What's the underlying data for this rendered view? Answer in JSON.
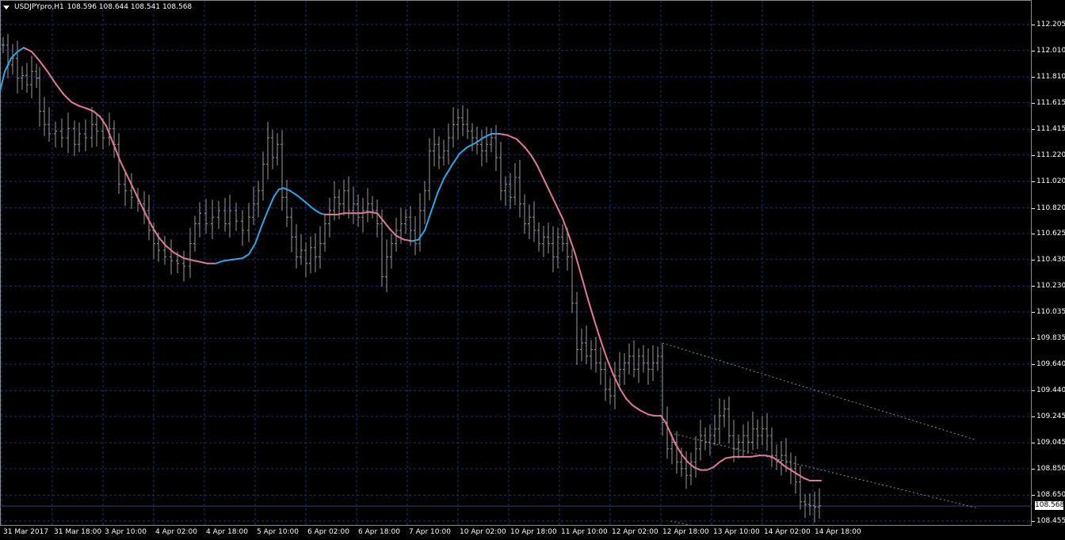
{
  "header": {
    "symbol": "USDJPYpro,H1",
    "ohlc": "108.596 108.644 108.541 108.568"
  },
  "colors": {
    "background": "#000000",
    "grid": "#1c2f6e",
    "bars": "#9a9a9a",
    "ma_rising": "#2aa7e6",
    "ma_falling": "#e07a95",
    "channel": "#8a8a8a",
    "axis_text": "#ffffff"
  },
  "price_axis": {
    "ticks": [
      "112.205",
      "112.010",
      "111.810",
      "111.615",
      "111.415",
      "111.220",
      "111.020",
      "110.820",
      "110.625",
      "110.430",
      "110.230",
      "110.035",
      "109.835",
      "109.640",
      "109.440",
      "109.245",
      "109.045",
      "108.850",
      "108.650",
      "108.455"
    ],
    "current_price": "108.568"
  },
  "time_axis": {
    "ticks": [
      "31 Mar 2017",
      "31 Mar 18:00",
      "3 Apr 10:00",
      "4 Apr 02:00",
      "4 Apr 18:00",
      "5 Apr 10:00",
      "6 Apr 02:00",
      "6 Apr 18:00",
      "7 Apr 10:00",
      "10 Apr 02:00",
      "10 Apr 18:00",
      "11 Apr 10:00",
      "12 Apr 02:00",
      "12 Apr 18:00",
      "13 Apr 10:00",
      "14 Apr 02:00",
      "14 Apr 18:00"
    ]
  },
  "chart_data": {
    "type": "ohlc_bars",
    "ylim": [
      108.455,
      112.205
    ],
    "ma_path": [
      [
        0,
        111.7
      ],
      [
        6,
        111.85
      ],
      [
        14,
        111.95
      ],
      [
        22,
        112.0
      ],
      [
        30,
        112.03
      ],
      [
        40,
        112.0
      ],
      [
        50,
        111.93
      ],
      [
        60,
        111.85
      ],
      [
        70,
        111.76
      ],
      [
        80,
        111.68
      ],
      [
        90,
        111.62
      ],
      [
        100,
        111.59
      ],
      [
        110,
        111.57
      ],
      [
        118,
        111.55
      ],
      [
        126,
        111.51
      ],
      [
        134,
        111.44
      ],
      [
        140,
        111.35
      ],
      [
        146,
        111.26
      ],
      [
        152,
        111.17
      ],
      [
        160,
        111.07
      ],
      [
        168,
        110.97
      ],
      [
        176,
        110.87
      ],
      [
        184,
        110.77
      ],
      [
        192,
        110.68
      ],
      [
        200,
        110.6
      ],
      [
        210,
        110.53
      ],
      [
        220,
        110.48
      ],
      [
        232,
        110.44
      ],
      [
        246,
        110.42
      ],
      [
        262,
        110.4
      ],
      [
        272,
        110.4
      ],
      [
        282,
        110.42
      ],
      [
        294,
        110.43
      ],
      [
        306,
        110.44
      ],
      [
        314,
        110.47
      ],
      [
        322,
        110.55
      ],
      [
        330,
        110.68
      ],
      [
        338,
        110.8
      ],
      [
        346,
        110.91
      ],
      [
        352,
        110.96
      ],
      [
        358,
        110.97
      ],
      [
        366,
        110.95
      ],
      [
        376,
        110.91
      ],
      [
        386,
        110.86
      ],
      [
        396,
        110.81
      ],
      [
        404,
        110.78
      ],
      [
        410,
        110.77
      ],
      [
        418,
        110.77
      ],
      [
        426,
        110.77
      ],
      [
        434,
        110.78
      ],
      [
        444,
        110.78
      ],
      [
        456,
        110.78
      ],
      [
        466,
        110.79
      ],
      [
        476,
        110.78
      ],
      [
        484,
        110.72
      ],
      [
        492,
        110.66
      ],
      [
        500,
        110.61
      ],
      [
        510,
        110.58
      ],
      [
        520,
        110.57
      ],
      [
        528,
        110.58
      ],
      [
        536,
        110.65
      ],
      [
        544,
        110.79
      ],
      [
        552,
        110.93
      ],
      [
        560,
        111.04
      ],
      [
        570,
        111.14
      ],
      [
        580,
        111.23
      ],
      [
        590,
        111.28
      ],
      [
        600,
        111.31
      ],
      [
        610,
        111.35
      ],
      [
        620,
        111.38
      ],
      [
        630,
        111.38
      ],
      [
        640,
        111.37
      ],
      [
        652,
        111.34
      ],
      [
        662,
        111.28
      ],
      [
        670,
        111.22
      ],
      [
        678,
        111.14
      ],
      [
        686,
        111.04
      ],
      [
        694,
        110.94
      ],
      [
        702,
        110.84
      ],
      [
        710,
        110.74
      ],
      [
        718,
        110.61
      ],
      [
        726,
        110.47
      ],
      [
        734,
        110.3
      ],
      [
        742,
        110.13
      ],
      [
        750,
        109.97
      ],
      [
        758,
        109.82
      ],
      [
        766,
        109.68
      ],
      [
        774,
        109.56
      ],
      [
        782,
        109.46
      ],
      [
        790,
        109.38
      ],
      [
        798,
        109.33
      ],
      [
        808,
        109.29
      ],
      [
        818,
        109.26
      ],
      [
        826,
        109.25
      ],
      [
        834,
        109.25
      ],
      [
        840,
        109.2
      ],
      [
        846,
        109.12
      ],
      [
        852,
        109.04
      ],
      [
        860,
        108.96
      ],
      [
        868,
        108.9
      ],
      [
        876,
        108.86
      ],
      [
        884,
        108.84
      ],
      [
        892,
        108.84
      ],
      [
        900,
        108.86
      ],
      [
        908,
        108.9
      ],
      [
        916,
        108.93
      ],
      [
        926,
        108.94
      ],
      [
        936,
        108.94
      ],
      [
        948,
        108.94
      ],
      [
        958,
        108.95
      ],
      [
        966,
        108.95
      ],
      [
        974,
        108.94
      ],
      [
        982,
        108.91
      ],
      [
        990,
        108.87
      ],
      [
        998,
        108.84
      ],
      [
        1006,
        108.81
      ],
      [
        1014,
        108.78
      ],
      [
        1022,
        108.76
      ],
      [
        1032,
        108.76
      ],
      [
        1036,
        108.76
      ]
    ],
    "ma_turns": [
      30,
      272,
      358,
      410,
      520,
      630
    ],
    "close_path": [
      [
        4,
        112.05
      ],
      [
        10,
        111.9
      ],
      [
        16,
        111.95
      ],
      [
        22,
        111.8
      ],
      [
        28,
        111.82
      ],
      [
        34,
        111.75
      ],
      [
        40,
        111.85
      ],
      [
        46,
        111.8
      ],
      [
        50,
        111.55
      ],
      [
        56,
        111.45
      ],
      [
        62,
        111.38
      ],
      [
        70,
        111.4
      ],
      [
        78,
        111.35
      ],
      [
        86,
        111.42
      ],
      [
        94,
        111.3
      ],
      [
        100,
        111.38
      ],
      [
        108,
        111.35
      ],
      [
        116,
        111.45
      ],
      [
        122,
        111.4
      ],
      [
        130,
        111.35
      ],
      [
        138,
        111.42
      ],
      [
        144,
        111.3
      ],
      [
        150,
        111.0
      ],
      [
        158,
        110.95
      ],
      [
        166,
        110.9
      ],
      [
        174,
        110.85
      ],
      [
        182,
        110.8
      ],
      [
        188,
        110.65
      ],
      [
        194,
        110.55
      ],
      [
        200,
        110.5
      ],
      [
        208,
        110.45
      ],
      [
        216,
        110.42
      ],
      [
        224,
        110.4
      ],
      [
        232,
        110.38
      ],
      [
        240,
        110.55
      ],
      [
        246,
        110.7
      ],
      [
        252,
        110.78
      ],
      [
        260,
        110.7
      ],
      [
        268,
        110.75
      ],
      [
        276,
        110.8
      ],
      [
        284,
        110.7
      ],
      [
        290,
        110.8
      ],
      [
        298,
        110.72
      ],
      [
        306,
        110.65
      ],
      [
        314,
        110.75
      ],
      [
        320,
        110.85
      ],
      [
        326,
        110.95
      ],
      [
        332,
        111.15
      ],
      [
        338,
        111.35
      ],
      [
        344,
        111.2
      ],
      [
        350,
        111.3
      ],
      [
        356,
        110.9
      ],
      [
        362,
        110.75
      ],
      [
        368,
        110.6
      ],
      [
        374,
        110.45
      ],
      [
        380,
        110.5
      ],
      [
        386,
        110.4
      ],
      [
        392,
        110.52
      ],
      [
        398,
        110.45
      ],
      [
        404,
        110.55
      ],
      [
        410,
        110.7
      ],
      [
        416,
        110.8
      ],
      [
        422,
        110.9
      ],
      [
        428,
        110.85
      ],
      [
        434,
        110.95
      ],
      [
        440,
        110.8
      ],
      [
        446,
        110.85
      ],
      [
        452,
        110.75
      ],
      [
        458,
        110.8
      ],
      [
        464,
        110.85
      ],
      [
        470,
        110.8
      ],
      [
        476,
        110.7
      ],
      [
        482,
        110.3
      ],
      [
        488,
        110.45
      ],
      [
        494,
        110.55
      ],
      [
        500,
        110.65
      ],
      [
        506,
        110.7
      ],
      [
        512,
        110.75
      ],
      [
        518,
        110.65
      ],
      [
        524,
        110.55
      ],
      [
        530,
        110.8
      ],
      [
        536,
        110.95
      ],
      [
        542,
        111.25
      ],
      [
        548,
        111.3
      ],
      [
        554,
        111.2
      ],
      [
        560,
        111.25
      ],
      [
        566,
        111.35
      ],
      [
        572,
        111.45
      ],
      [
        578,
        111.5
      ],
      [
        584,
        111.45
      ],
      [
        590,
        111.4
      ],
      [
        596,
        111.35
      ],
      [
        602,
        111.3
      ],
      [
        608,
        111.25
      ],
      [
        614,
        111.3
      ],
      [
        620,
        111.35
      ],
      [
        626,
        111.2
      ],
      [
        632,
        110.95
      ],
      [
        638,
        111.0
      ],
      [
        644,
        110.9
      ],
      [
        650,
        111.05
      ],
      [
        656,
        110.85
      ],
      [
        662,
        110.7
      ],
      [
        668,
        110.75
      ],
      [
        674,
        110.65
      ],
      [
        680,
        110.55
      ],
      [
        686,
        110.6
      ],
      [
        692,
        110.55
      ],
      [
        698,
        110.45
      ],
      [
        704,
        110.6
      ],
      [
        710,
        110.55
      ],
      [
        716,
        110.45
      ],
      [
        722,
        110.1
      ],
      [
        728,
        109.75
      ],
      [
        734,
        109.8
      ],
      [
        740,
        109.7
      ],
      [
        746,
        109.75
      ],
      [
        752,
        109.65
      ],
      [
        758,
        109.6
      ],
      [
        764,
        109.45
      ],
      [
        770,
        109.4
      ],
      [
        776,
        109.55
      ],
      [
        782,
        109.6
      ],
      [
        788,
        109.65
      ],
      [
        794,
        109.7
      ],
      [
        800,
        109.6
      ],
      [
        806,
        109.7
      ],
      [
        812,
        109.65
      ],
      [
        818,
        109.6
      ],
      [
        824,
        109.65
      ],
      [
        830,
        109.7
      ],
      [
        836,
        109.2
      ],
      [
        842,
        109.0
      ],
      [
        848,
        109.05
      ],
      [
        854,
        108.9
      ],
      [
        860,
        108.85
      ],
      [
        866,
        108.8
      ],
      [
        872,
        108.9
      ],
      [
        878,
        109.0
      ],
      [
        884,
        109.1
      ],
      [
        890,
        109.05
      ],
      [
        896,
        109.1
      ],
      [
        902,
        109.15
      ],
      [
        908,
        109.25
      ],
      [
        914,
        109.3
      ],
      [
        920,
        109.1
      ],
      [
        926,
        109.0
      ],
      [
        932,
        109.05
      ],
      [
        938,
        109.1
      ],
      [
        944,
        109.05
      ],
      [
        950,
        109.15
      ],
      [
        956,
        109.1
      ],
      [
        962,
        109.15
      ],
      [
        968,
        109.1
      ],
      [
        974,
        108.95
      ],
      [
        980,
        108.9
      ],
      [
        986,
        108.95
      ],
      [
        992,
        108.9
      ],
      [
        998,
        108.85
      ],
      [
        1004,
        108.75
      ],
      [
        1010,
        108.6
      ],
      [
        1016,
        108.58
      ],
      [
        1022,
        108.57
      ],
      [
        1028,
        108.56
      ],
      [
        1034,
        108.57
      ]
    ],
    "channel": {
      "upper": [
        [
          836,
          109.8
        ],
        [
          1230,
          109.07
        ]
      ],
      "middle": [
        [
          846,
          109.12
        ],
        [
          1235,
          108.55
        ]
      ],
      "lower": [
        [
          846,
          108.455
        ],
        [
          890,
          108.4
        ]
      ]
    }
  }
}
